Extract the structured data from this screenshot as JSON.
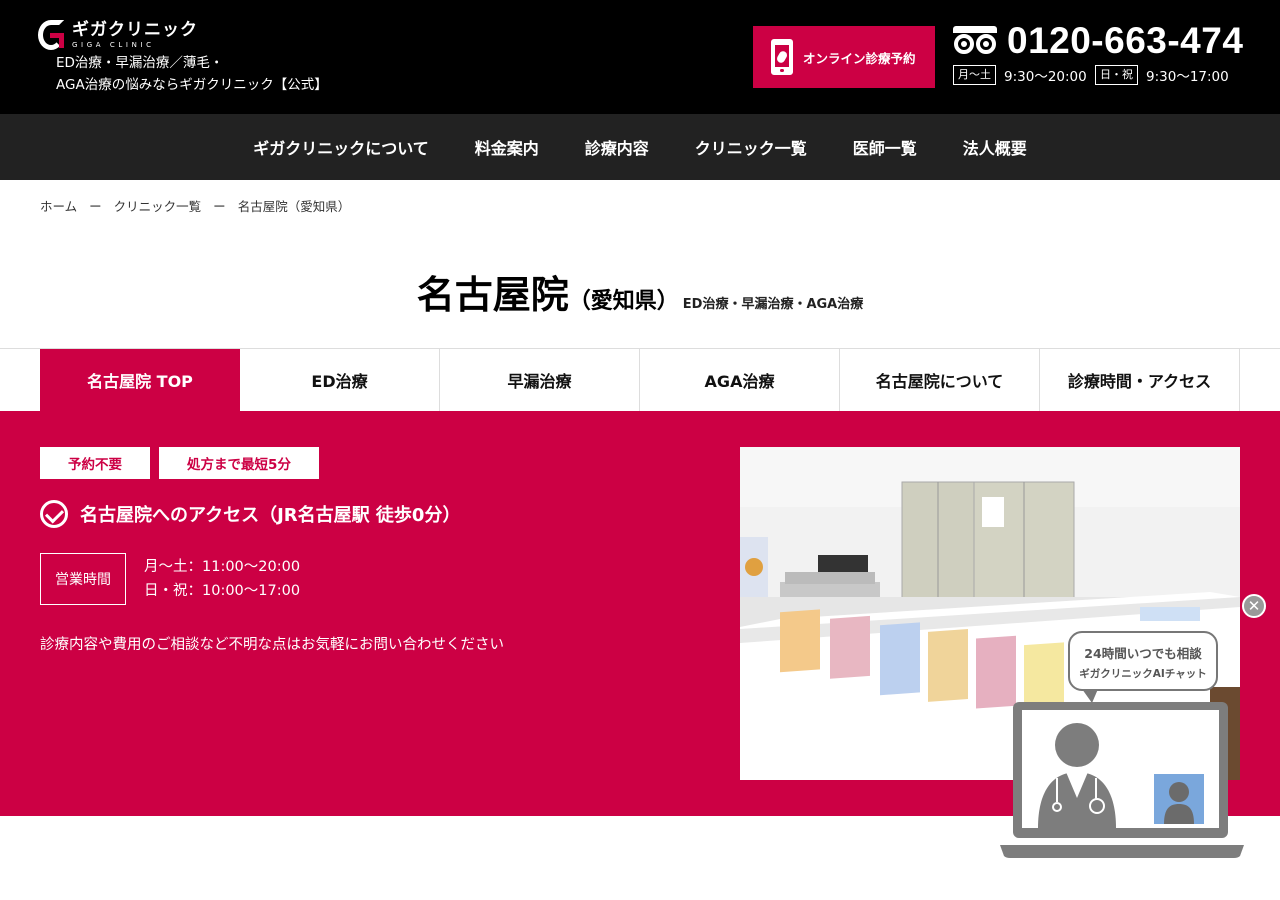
{
  "header": {
    "logo_name": "ギガクリニック",
    "logo_sub": "GIGA CLINIC",
    "tagline_line1": "ED治療・早漏治療／薄毛・",
    "tagline_line2": "AGA治療の悩みならギガクリニック【公式】",
    "reserve_label": "オンライン診療予約",
    "phone": "0120-663-474",
    "hours": [
      {
        "day": "月〜土",
        "time": "9:30〜20:00"
      },
      {
        "day": "日・祝",
        "time": "9:30〜17:00"
      }
    ]
  },
  "nav": [
    "ギガクリニックについて",
    "料金案内",
    "診療内容",
    "クリニック一覧",
    "医師一覧",
    "法人概要"
  ],
  "breadcrumb": [
    "ホーム",
    "クリニック一覧",
    "名古屋院（愛知県）"
  ],
  "breadcrumb_sep": "ー",
  "title": {
    "main": "名古屋院",
    "pref": "（愛知県）",
    "sub": "ED治療・早漏治療・AGA治療"
  },
  "tabs": [
    "名古屋院 TOP",
    "ED治療",
    "早漏治療",
    "AGA治療",
    "名古屋院について",
    "診療時間・アクセス"
  ],
  "hero": {
    "badges": [
      "予約不要",
      "処方まで最短5分"
    ],
    "access": "名古屋院へのアクセス（JR名古屋駅 徒歩0分）",
    "hours_label": "営業時間",
    "hours_lines": [
      "月〜土：11:00〜20:00",
      "日・祝：10:00〜17:00"
    ],
    "inquiry": "診療内容や費用のご相談など不明な点はお気軽にお問い合わせください"
  },
  "chat": {
    "close": "✕",
    "line1": "24時間いつでも相談",
    "line2": "ギガクリニックAIチャット"
  },
  "colors": {
    "brand": "#cc0044",
    "header_bg": "#000000",
    "nav_bg": "#222222"
  }
}
